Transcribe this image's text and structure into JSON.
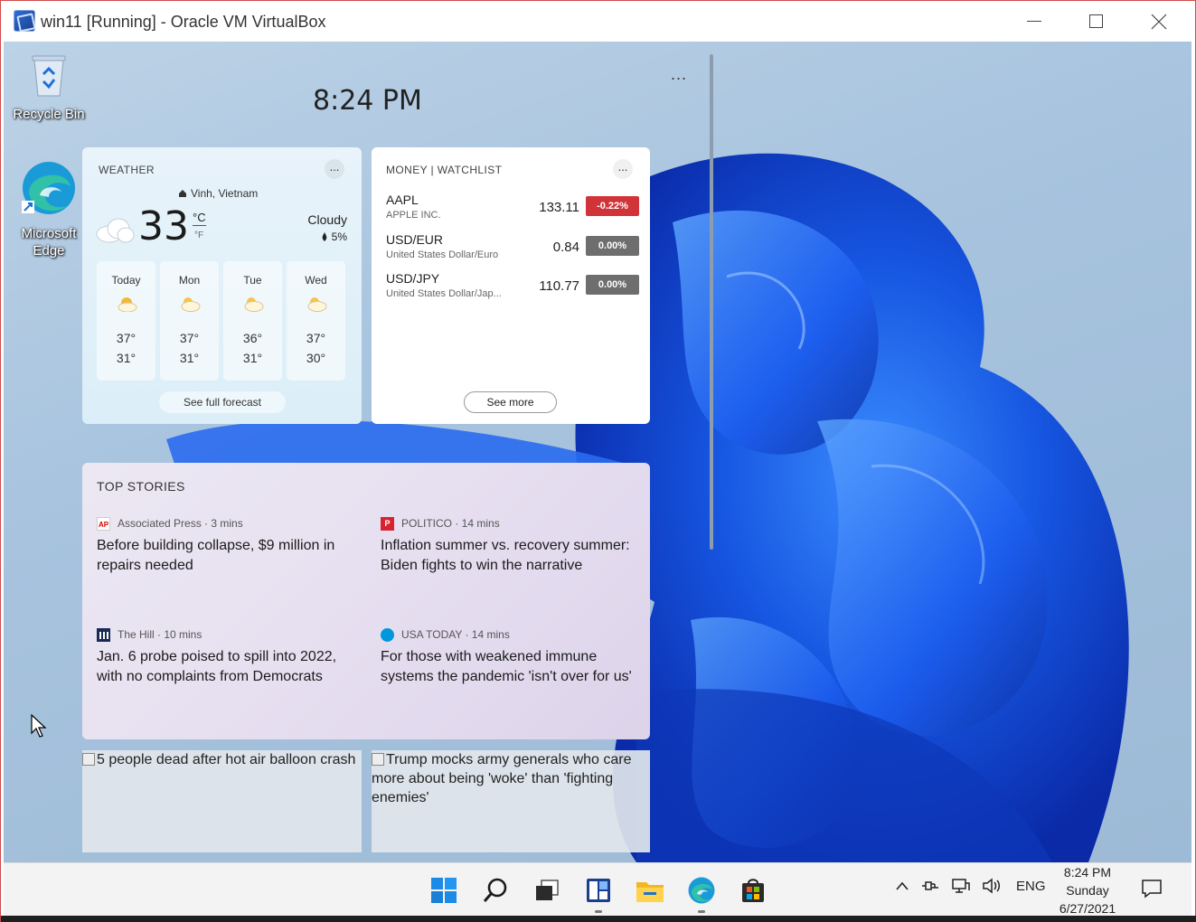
{
  "window": {
    "title": "win11 [Running] - Oracle VM VirtualBox",
    "close_glyph": "✕"
  },
  "desktop": {
    "icons": [
      {
        "label": "Recycle Bin",
        "icon": "recycle-bin-icon"
      },
      {
        "label": "Microsoft Edge",
        "icon": "edge-icon"
      }
    ],
    "clock": "8:24 PM",
    "more": "..."
  },
  "weather": {
    "title": "WEATHER",
    "more": "...",
    "location": "Vinh, Vietnam",
    "temp": "33",
    "unit_c": "°C",
    "unit_f": "°F",
    "condition": "Cloudy",
    "precip": "5%",
    "forecast": [
      {
        "day": "Today",
        "hi": "37°",
        "lo": "31°"
      },
      {
        "day": "Mon",
        "hi": "37°",
        "lo": "31°"
      },
      {
        "day": "Tue",
        "hi": "36°",
        "lo": "31°"
      },
      {
        "day": "Wed",
        "hi": "37°",
        "lo": "30°"
      }
    ],
    "full_forecast": "See full forecast"
  },
  "money": {
    "title": "MONEY | WATCHLIST",
    "more": "...",
    "stocks": [
      {
        "symbol": "AAPL",
        "name": "APPLE INC.",
        "price": "133.11",
        "change": "-0.22%",
        "color": "#d13438"
      },
      {
        "symbol": "USD/EUR",
        "name": "United States Dollar/Euro",
        "price": "0.84",
        "change": "0.00%",
        "color": "#6e6e6e"
      },
      {
        "symbol": "USD/JPY",
        "name": "United States Dollar/Jap...",
        "price": "110.77",
        "change": "0.00%",
        "color": "#6e6e6e"
      }
    ],
    "see_more": "See more"
  },
  "stories": {
    "title": "TOP STORIES",
    "items": [
      {
        "logo": "AP",
        "source": "Associated Press · 3 mins",
        "headline": "Before building collapse, $9 million in repairs needed"
      },
      {
        "logo": "P",
        "source": "POLITICO · 14 mins",
        "headline": "Inflation summer vs. recovery summer: Biden fights to win the narrative"
      },
      {
        "logo": "hill",
        "source": "The Hill · 10 mins",
        "headline": "Jan. 6 probe poised to spill into 2022, with no complaints from Democrats"
      },
      {
        "logo": "usa",
        "source": "USA TODAY · 14 mins",
        "headline": "For those with weakened immune systems the pandemic 'isn't over for us'"
      }
    ]
  },
  "image_cards": [
    {
      "alt": "5 people dead after hot air balloon crash"
    },
    {
      "alt": "Trump mocks army generals who care more about being 'woke' than 'fighting enemies'"
    }
  ],
  "taskbar": {
    "apps": [
      "start-icon",
      "search-icon",
      "task-view-icon",
      "widgets-icon",
      "file-explorer-icon",
      "edge-icon",
      "store-icon"
    ],
    "tray_chevron": "^",
    "lang": "ENG",
    "time": "8:24 PM",
    "day": "Sunday",
    "date": "6/27/2021"
  },
  "colors": {
    "accent": "#0067c0",
    "negative": "#d13438",
    "neutral": "#6e6e6e"
  }
}
